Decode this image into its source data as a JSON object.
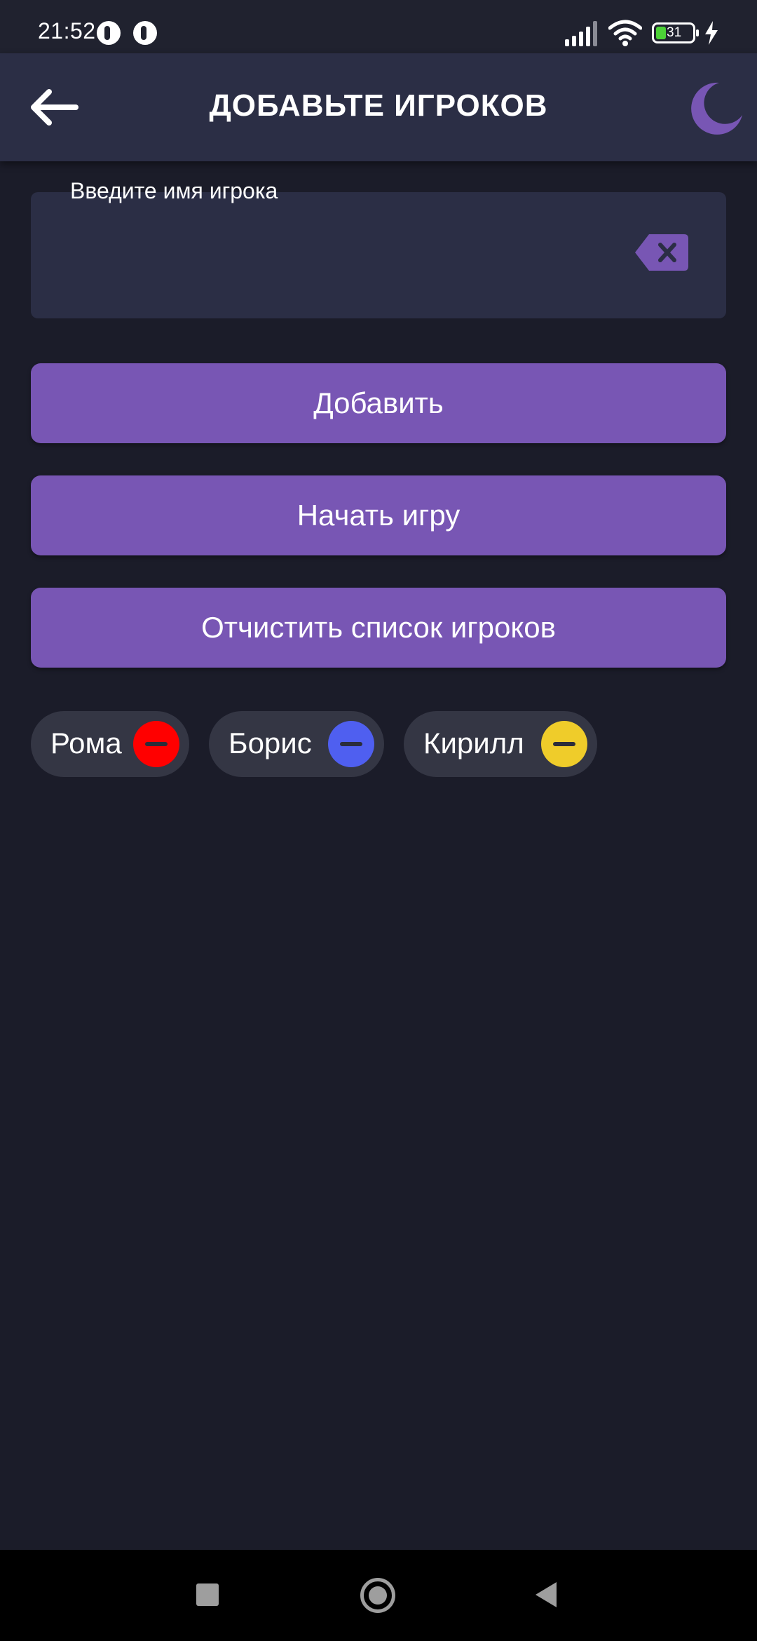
{
  "status_bar": {
    "time": "21:52",
    "battery_level": "31"
  },
  "header": {
    "title": "ДОБАВЬТЕ ИГРОКОВ"
  },
  "player_input": {
    "label": "Введите имя игрока",
    "value": ""
  },
  "buttons": {
    "add": "Добавить",
    "start": "Начать игру",
    "clear": "Отчистить список игроков"
  },
  "players": [
    {
      "name": "Рома",
      "color": "#ff0000"
    },
    {
      "name": "Борис",
      "color": "#4f5ff0"
    },
    {
      "name": "Кирилл",
      "color": "#efcc2a"
    }
  ],
  "theme": {
    "background": "#1b1c29",
    "surface": "#2b2e45",
    "accent": "#7856b4",
    "chip": "#343644"
  }
}
